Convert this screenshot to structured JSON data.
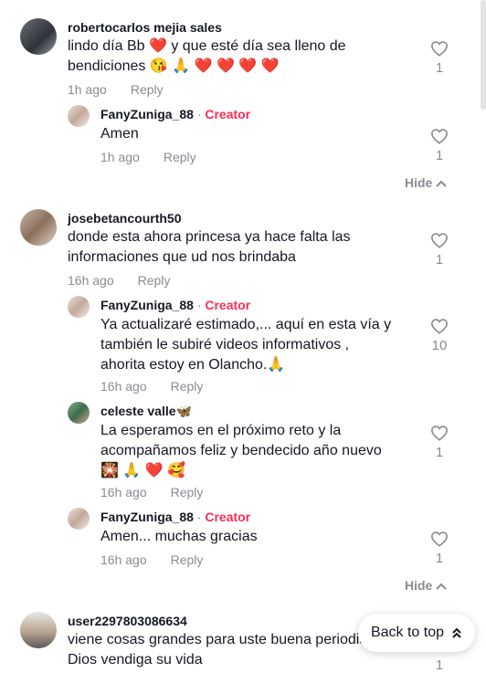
{
  "comments": [
    {
      "user": "robertocarlos mejia sales",
      "text": "lindo día Bb ❤️ y que esté día sea lleno de bendiciones 😘 🙏 ❤️ ❤️ ❤️ ❤️",
      "time": "1h ago",
      "reply_label": "Reply",
      "likes": "1",
      "replies": [
        {
          "user": "FanyZuniga_88",
          "badge": "Creator",
          "text": "Amen",
          "time": "1h ago",
          "reply_label": "Reply",
          "likes": "1"
        }
      ],
      "hide_label": "Hide"
    },
    {
      "user": "josebetancourth50",
      "text": "donde esta ahora princesa ya hace falta las informaciones que ud nos brindaba",
      "time": "16h ago",
      "reply_label": "Reply",
      "likes": "1",
      "replies": [
        {
          "user": "FanyZuniga_88",
          "badge": "Creator",
          "text": "Ya actualizaré estimado,... aquí en esta vía y también le subiré videos informativos , ahorita estoy en Olancho.🙏",
          "time": "16h ago",
          "reply_label": "Reply",
          "likes": "10"
        },
        {
          "user": "celeste valle🦋",
          "badge": "",
          "text": "La esperamos en el próximo reto y la acompañamos feliz y bendecido año nuevo 🎇 🙏 ❤️ 🥰",
          "time": "16h ago",
          "reply_label": "Reply",
          "likes": "1"
        },
        {
          "user": "FanyZuniga_88",
          "badge": "Creator",
          "text": "Amen... muchas gracias",
          "time": "16h ago",
          "reply_label": "Reply",
          "likes": "1"
        }
      ],
      "hide_label": "Hide"
    },
    {
      "user": "user2297803086634",
      "text": "viene cosas grandes para uste buena periodista",
      "text2": "Dios vendiga su vida",
      "likes": "1"
    }
  ],
  "back_to_top_label": "Back to top",
  "creator_separator": "·",
  "icons": {
    "like": "heart-outline-icon",
    "hide": "chevron-up-icon",
    "back_to_top": "double-chevron-up-icon"
  }
}
